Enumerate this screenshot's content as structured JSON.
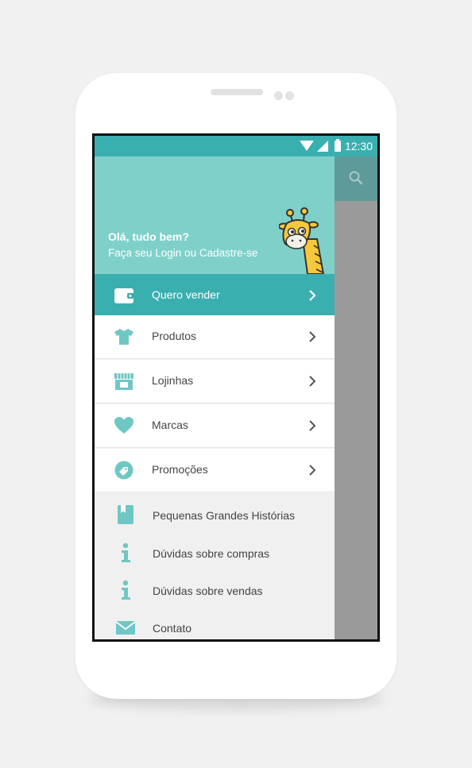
{
  "status_bar": {
    "time": "12:30"
  },
  "drawer": {
    "header": {
      "greeting": "Olá, tudo bem?",
      "login_text": "Faça seu Login ou Cadastre-se"
    },
    "primary_items": [
      {
        "label": "Quero vender",
        "icon": "wallet-icon"
      },
      {
        "label": "Produtos",
        "icon": "shirt-icon"
      },
      {
        "label": "Lojinhas",
        "icon": "store-icon"
      },
      {
        "label": "Marcas",
        "icon": "heart-icon"
      },
      {
        "label": "Promoções",
        "icon": "tag-icon"
      }
    ],
    "secondary_items": [
      {
        "label": "Pequenas Grandes Histórias",
        "icon": "book-icon"
      },
      {
        "label": "Dúvidas sobre compras",
        "icon": "info-icon"
      },
      {
        "label": "Dúvidas sobre vendas",
        "icon": "info-icon"
      },
      {
        "label": "Contato",
        "icon": "mail-icon"
      }
    ]
  },
  "colors": {
    "accent": "#3aafb0",
    "header": "#7fd0c9",
    "icon": "#6fc7c4",
    "backdrop": "#9a9a9a",
    "secondary_background": "#f0f0f0"
  }
}
